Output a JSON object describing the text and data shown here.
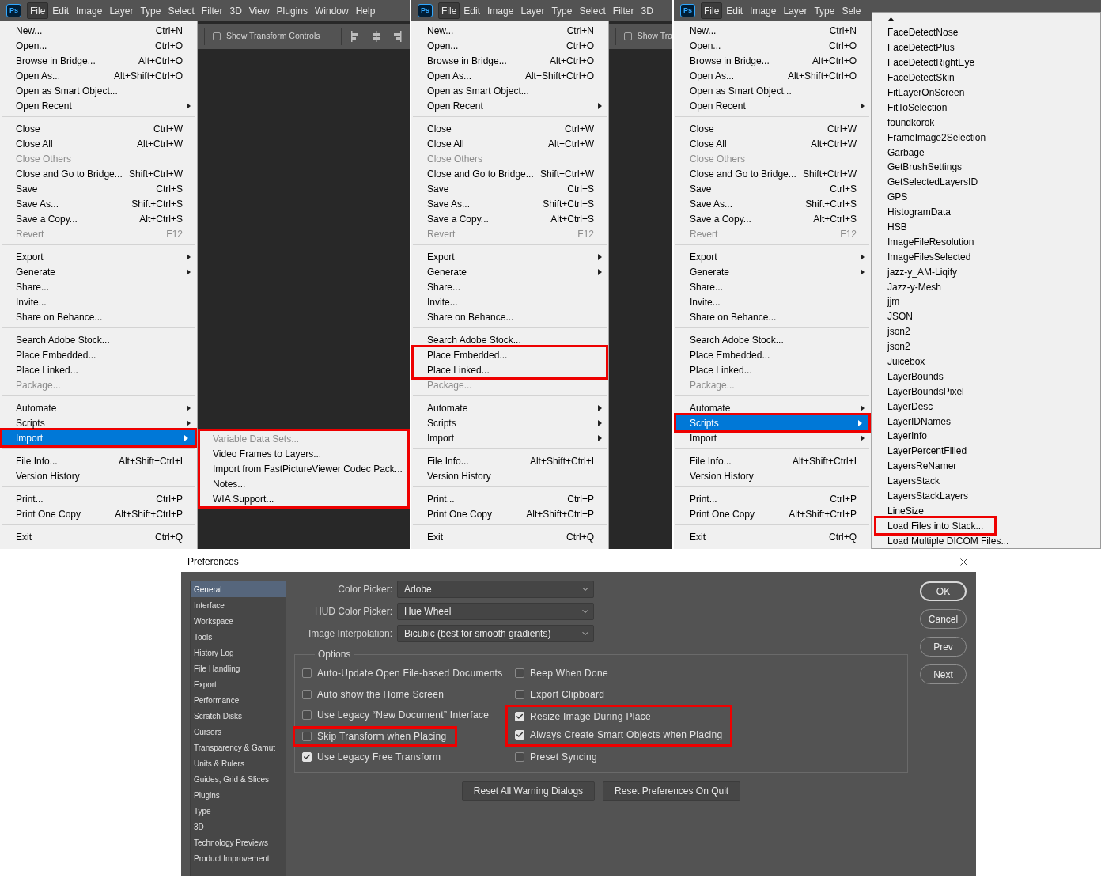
{
  "panels": [
    {
      "menubar": {
        "logo": "Ps",
        "items": [
          {
            "label": "File",
            "selected": true
          },
          {
            "label": "Edit",
            "selected": false
          },
          {
            "label": "Image",
            "selected": false
          },
          {
            "label": "Layer",
            "selected": false
          },
          {
            "label": "Type",
            "selected": false
          },
          {
            "label": "Select",
            "selected": false
          },
          {
            "label": "Filter",
            "selected": false
          },
          {
            "label": "3D",
            "selected": false
          },
          {
            "label": "View",
            "selected": false
          },
          {
            "label": "Plugins",
            "selected": false
          },
          {
            "label": "Window",
            "selected": false
          },
          {
            "label": "Help",
            "selected": false
          }
        ]
      },
      "options_bar": {
        "label": "Show Transform Controls",
        "checked": false,
        "align_icons": true
      },
      "file_menu": {
        "sections": [
          [
            {
              "label": "New...",
              "shortcut": "Ctrl+N",
              "arrow": false,
              "disabled": false,
              "selected": false,
              "annotated": false
            },
            {
              "label": "Open...",
              "shortcut": "Ctrl+O",
              "arrow": false,
              "disabled": false,
              "selected": false,
              "annotated": false
            },
            {
              "label": "Browse in Bridge...",
              "shortcut": "Alt+Ctrl+O",
              "arrow": false,
              "disabled": false,
              "selected": false,
              "annotated": false
            },
            {
              "label": "Open As...",
              "shortcut": "Alt+Shift+Ctrl+O",
              "arrow": false,
              "disabled": false,
              "selected": false,
              "annotated": false
            },
            {
              "label": "Open as Smart Object...",
              "arrow": false,
              "disabled": false,
              "selected": false,
              "annotated": false
            },
            {
              "label": "Open Recent",
              "arrow": true,
              "disabled": false,
              "selected": false,
              "annotated": false
            }
          ],
          [
            {
              "label": "Close",
              "shortcut": "Ctrl+W",
              "arrow": false,
              "disabled": false,
              "selected": false,
              "annotated": false
            },
            {
              "label": "Close All",
              "shortcut": "Alt+Ctrl+W",
              "arrow": false,
              "disabled": false,
              "selected": false,
              "annotated": false
            },
            {
              "label": "Close Others",
              "arrow": false,
              "disabled": true,
              "selected": false,
              "annotated": false
            },
            {
              "label": "Close and Go to Bridge...",
              "shortcut": "Shift+Ctrl+W",
              "arrow": false,
              "disabled": false,
              "selected": false,
              "annotated": false
            },
            {
              "label": "Save",
              "shortcut": "Ctrl+S",
              "arrow": false,
              "disabled": false,
              "selected": false,
              "annotated": false
            },
            {
              "label": "Save As...",
              "shortcut": "Shift+Ctrl+S",
              "arrow": false,
              "disabled": false,
              "selected": false,
              "annotated": false
            },
            {
              "label": "Save a Copy...",
              "shortcut": "Alt+Ctrl+S",
              "arrow": false,
              "disabled": false,
              "selected": false,
              "annotated": false
            },
            {
              "label": "Revert",
              "shortcut": "F12",
              "arrow": false,
              "disabled": true,
              "selected": false,
              "annotated": false
            }
          ],
          [
            {
              "label": "Export",
              "arrow": true,
              "disabled": false,
              "selected": false,
              "annotated": false
            },
            {
              "label": "Generate",
              "arrow": true,
              "disabled": false,
              "selected": false,
              "annotated": false
            },
            {
              "label": "Share...",
              "arrow": false,
              "disabled": false,
              "selected": false,
              "annotated": false
            },
            {
              "label": "Invite...",
              "arrow": false,
              "disabled": false,
              "selected": false,
              "annotated": false
            },
            {
              "label": "Share on Behance...",
              "arrow": false,
              "disabled": false,
              "selected": false,
              "annotated": false
            }
          ],
          [
            {
              "label": "Search Adobe Stock...",
              "arrow": false,
              "disabled": false,
              "selected": false,
              "annotated": false
            },
            {
              "label": "Place Embedded...",
              "arrow": false,
              "disabled": false,
              "selected": false,
              "annotated": false
            },
            {
              "label": "Place Linked...",
              "arrow": false,
              "disabled": false,
              "selected": false,
              "annotated": false
            },
            {
              "label": "Package...",
              "arrow": false,
              "disabled": true,
              "selected": false,
              "annotated": false
            }
          ],
          [
            {
              "label": "Automate",
              "arrow": true,
              "disabled": false,
              "selected": false,
              "annotated": false
            },
            {
              "label": "Scripts",
              "arrow": true,
              "disabled": false,
              "selected": false,
              "annotated": false
            },
            {
              "label": "Import",
              "arrow": true,
              "disabled": false,
              "selected": true,
              "annotated": true,
              "submenu": {
                "kind": "cascade",
                "annotated": true,
                "scroll_up": false,
                "items": [
                  {
                    "label": "Variable Data Sets...",
                    "disabled": true,
                    "annotated": false
                  },
                  {
                    "label": "Video Frames to Layers...",
                    "disabled": false,
                    "annotated": false
                  },
                  {
                    "label": "Import from FastPictureViewer Codec Pack...",
                    "disabled": false,
                    "annotated": false
                  },
                  {
                    "label": "Notes...",
                    "disabled": false,
                    "annotated": false
                  },
                  {
                    "label": "WIA Support...",
                    "disabled": false,
                    "annotated": false
                  }
                ]
              }
            }
          ],
          [
            {
              "label": "File Info...",
              "shortcut": "Alt+Shift+Ctrl+I",
              "arrow": false,
              "disabled": false,
              "selected": false,
              "annotated": false
            },
            {
              "label": "Version History",
              "arrow": false,
              "disabled": false,
              "selected": false,
              "annotated": false
            }
          ],
          [
            {
              "label": "Print...",
              "shortcut": "Ctrl+P",
              "arrow": false,
              "disabled": false,
              "selected": false,
              "annotated": false
            },
            {
              "label": "Print One Copy",
              "shortcut": "Alt+Shift+Ctrl+P",
              "arrow": false,
              "disabled": false,
              "selected": false,
              "annotated": false
            }
          ],
          [
            {
              "label": "Exit",
              "shortcut": "Ctrl+Q",
              "arrow": false,
              "disabled": false,
              "selected": false,
              "annotated": false
            }
          ]
        ]
      }
    },
    {
      "menubar": {
        "logo": "Ps",
        "items": [
          {
            "label": "File",
            "selected": true
          },
          {
            "label": "Edit",
            "selected": false
          },
          {
            "label": "Image",
            "selected": false
          },
          {
            "label": "Layer",
            "selected": false
          },
          {
            "label": "Type",
            "selected": false
          },
          {
            "label": "Select",
            "selected": false
          },
          {
            "label": "Filter",
            "selected": false
          },
          {
            "label": "3D",
            "selected": false
          }
        ]
      },
      "options_bar": {
        "label": "Show Tra",
        "checked": false,
        "align_icons": false
      },
      "file_menu": {
        "sections": [
          [
            {
              "label": "New...",
              "shortcut": "Ctrl+N",
              "arrow": false,
              "disabled": false,
              "selected": false,
              "annotated": false
            },
            {
              "label": "Open...",
              "shortcut": "Ctrl+O",
              "arrow": false,
              "disabled": false,
              "selected": false,
              "annotated": false
            },
            {
              "label": "Browse in Bridge...",
              "shortcut": "Alt+Ctrl+O",
              "arrow": false,
              "disabled": false,
              "selected": false,
              "annotated": false
            },
            {
              "label": "Open As...",
              "shortcut": "Alt+Shift+Ctrl+O",
              "arrow": false,
              "disabled": false,
              "selected": false,
              "annotated": false
            },
            {
              "label": "Open as Smart Object...",
              "arrow": false,
              "disabled": false,
              "selected": false,
              "annotated": false
            },
            {
              "label": "Open Recent",
              "arrow": true,
              "disabled": false,
              "selected": false,
              "annotated": false
            }
          ],
          [
            {
              "label": "Close",
              "shortcut": "Ctrl+W",
              "arrow": false,
              "disabled": false,
              "selected": false,
              "annotated": false
            },
            {
              "label": "Close All",
              "shortcut": "Alt+Ctrl+W",
              "arrow": false,
              "disabled": false,
              "selected": false,
              "annotated": false
            },
            {
              "label": "Close Others",
              "arrow": false,
              "disabled": true,
              "selected": false,
              "annotated": false
            },
            {
              "label": "Close and Go to Bridge...",
              "shortcut": "Shift+Ctrl+W",
              "arrow": false,
              "disabled": false,
              "selected": false,
              "annotated": false
            },
            {
              "label": "Save",
              "shortcut": "Ctrl+S",
              "arrow": false,
              "disabled": false,
              "selected": false,
              "annotated": false
            },
            {
              "label": "Save As...",
              "shortcut": "Shift+Ctrl+S",
              "arrow": false,
              "disabled": false,
              "selected": false,
              "annotated": false
            },
            {
              "label": "Save a Copy...",
              "shortcut": "Alt+Ctrl+S",
              "arrow": false,
              "disabled": false,
              "selected": false,
              "annotated": false
            },
            {
              "label": "Revert",
              "shortcut": "F12",
              "arrow": false,
              "disabled": true,
              "selected": false,
              "annotated": false
            }
          ],
          [
            {
              "label": "Export",
              "arrow": true,
              "disabled": false,
              "selected": false,
              "annotated": false
            },
            {
              "label": "Generate",
              "arrow": true,
              "disabled": false,
              "selected": false,
              "annotated": false
            },
            {
              "label": "Share...",
              "arrow": false,
              "disabled": false,
              "selected": false,
              "annotated": false
            },
            {
              "label": "Invite...",
              "arrow": false,
              "disabled": false,
              "selected": false,
              "annotated": false
            },
            {
              "label": "Share on Behance...",
              "arrow": false,
              "disabled": false,
              "selected": false,
              "annotated": false
            }
          ],
          [
            {
              "label": "Search Adobe Stock...",
              "arrow": false,
              "disabled": false,
              "selected": false,
              "annotated": false
            },
            {
              "label": "Place Embedded...",
              "arrow": false,
              "disabled": false,
              "selected": false,
              "annotated": true
            },
            {
              "label": "Place Linked...",
              "arrow": false,
              "disabled": false,
              "selected": false,
              "annotated": true
            },
            {
              "label": "Package...",
              "arrow": false,
              "disabled": true,
              "selected": false,
              "annotated": false
            }
          ],
          [
            {
              "label": "Automate",
              "arrow": true,
              "disabled": false,
              "selected": false,
              "annotated": false
            },
            {
              "label": "Scripts",
              "arrow": true,
              "disabled": false,
              "selected": false,
              "annotated": false
            },
            {
              "label": "Import",
              "arrow": true,
              "disabled": false,
              "selected": false,
              "annotated": false
            }
          ],
          [
            {
              "label": "File Info...",
              "shortcut": "Alt+Shift+Ctrl+I",
              "arrow": false,
              "disabled": false,
              "selected": false,
              "annotated": false
            },
            {
              "label": "Version History",
              "arrow": false,
              "disabled": false,
              "selected": false,
              "annotated": false
            }
          ],
          [
            {
              "label": "Print...",
              "shortcut": "Ctrl+P",
              "arrow": false,
              "disabled": false,
              "selected": false,
              "annotated": false
            },
            {
              "label": "Print One Copy",
              "shortcut": "Alt+Shift+Ctrl+P",
              "arrow": false,
              "disabled": false,
              "selected": false,
              "annotated": false
            }
          ],
          [
            {
              "label": "Exit",
              "shortcut": "Ctrl+Q",
              "arrow": false,
              "disabled": false,
              "selected": false,
              "annotated": false
            }
          ]
        ]
      }
    },
    {
      "menubar": {
        "logo": "Ps",
        "items": [
          {
            "label": "File",
            "selected": true
          },
          {
            "label": "Edit",
            "selected": false
          },
          {
            "label": "Image",
            "selected": false
          },
          {
            "label": "Layer",
            "selected": false
          },
          {
            "label": "Type",
            "selected": false
          },
          {
            "label": "Sele",
            "selected": false
          }
        ]
      },
      "file_menu": {
        "sections": [
          [
            {
              "label": "New...",
              "shortcut": "Ctrl+N",
              "arrow": false,
              "disabled": false,
              "selected": false,
              "annotated": false
            },
            {
              "label": "Open...",
              "shortcut": "Ctrl+O",
              "arrow": false,
              "disabled": false,
              "selected": false,
              "annotated": false
            },
            {
              "label": "Browse in Bridge...",
              "shortcut": "Alt+Ctrl+O",
              "arrow": false,
              "disabled": false,
              "selected": false,
              "annotated": false
            },
            {
              "label": "Open As...",
              "shortcut": "Alt+Shift+Ctrl+O",
              "arrow": false,
              "disabled": false,
              "selected": false,
              "annotated": false
            },
            {
              "label": "Open as Smart Object...",
              "arrow": false,
              "disabled": false,
              "selected": false,
              "annotated": false
            },
            {
              "label": "Open Recent",
              "arrow": true,
              "disabled": false,
              "selected": false,
              "annotated": false
            }
          ],
          [
            {
              "label": "Close",
              "shortcut": "Ctrl+W",
              "arrow": false,
              "disabled": false,
              "selected": false,
              "annotated": false
            },
            {
              "label": "Close All",
              "shortcut": "Alt+Ctrl+W",
              "arrow": false,
              "disabled": false,
              "selected": false,
              "annotated": false
            },
            {
              "label": "Close Others",
              "arrow": false,
              "disabled": true,
              "selected": false,
              "annotated": false
            },
            {
              "label": "Close and Go to Bridge...",
              "shortcut": "Shift+Ctrl+W",
              "arrow": false,
              "disabled": false,
              "selected": false,
              "annotated": false
            },
            {
              "label": "Save",
              "shortcut": "Ctrl+S",
              "arrow": false,
              "disabled": false,
              "selected": false,
              "annotated": false
            },
            {
              "label": "Save As...",
              "shortcut": "Shift+Ctrl+S",
              "arrow": false,
              "disabled": false,
              "selected": false,
              "annotated": false
            },
            {
              "label": "Save a Copy...",
              "shortcut": "Alt+Ctrl+S",
              "arrow": false,
              "disabled": false,
              "selected": false,
              "annotated": false
            },
            {
              "label": "Revert",
              "shortcut": "F12",
              "arrow": false,
              "disabled": true,
              "selected": false,
              "annotated": false
            }
          ],
          [
            {
              "label": "Export",
              "arrow": true,
              "disabled": false,
              "selected": false,
              "annotated": false
            },
            {
              "label": "Generate",
              "arrow": true,
              "disabled": false,
              "selected": false,
              "annotated": false
            },
            {
              "label": "Share...",
              "arrow": false,
              "disabled": false,
              "selected": false,
              "annotated": false
            },
            {
              "label": "Invite...",
              "arrow": false,
              "disabled": false,
              "selected": false,
              "annotated": false
            },
            {
              "label": "Share on Behance...",
              "arrow": false,
              "disabled": false,
              "selected": false,
              "annotated": false
            }
          ],
          [
            {
              "label": "Search Adobe Stock...",
              "arrow": false,
              "disabled": false,
              "selected": false,
              "annotated": false
            },
            {
              "label": "Place Embedded...",
              "arrow": false,
              "disabled": false,
              "selected": false,
              "annotated": false
            },
            {
              "label": "Place Linked...",
              "arrow": false,
              "disabled": false,
              "selected": false,
              "annotated": false
            },
            {
              "label": "Package...",
              "arrow": false,
              "disabled": true,
              "selected": false,
              "annotated": false
            }
          ],
          [
            {
              "label": "Automate",
              "arrow": true,
              "disabled": false,
              "selected": false,
              "annotated": false
            },
            {
              "label": "Scripts",
              "arrow": true,
              "disabled": false,
              "selected": true,
              "annotated": true,
              "submenu": {
                "kind": "scrolling",
                "annotated": false,
                "scroll_up": true,
                "items": [
                  {
                    "label": "FaceDetectNose",
                    "disabled": false,
                    "annotated": false
                  },
                  {
                    "label": "FaceDetectPlus",
                    "disabled": false,
                    "annotated": false
                  },
                  {
                    "label": "FaceDetectRightEye",
                    "disabled": false,
                    "annotated": false
                  },
                  {
                    "label": "FaceDetectSkin",
                    "disabled": false,
                    "annotated": false
                  },
                  {
                    "label": "FitLayerOnScreen",
                    "disabled": false,
                    "annotated": false
                  },
                  {
                    "label": "FitToSelection",
                    "disabled": false,
                    "annotated": false
                  },
                  {
                    "label": "foundkorok",
                    "disabled": false,
                    "annotated": false
                  },
                  {
                    "label": "FrameImage2Selection",
                    "disabled": false,
                    "annotated": false
                  },
                  {
                    "label": "Garbage",
                    "disabled": false,
                    "annotated": false
                  },
                  {
                    "label": "GetBrushSettings",
                    "disabled": false,
                    "annotated": false
                  },
                  {
                    "label": "GetSelectedLayersID",
                    "disabled": false,
                    "annotated": false
                  },
                  {
                    "label": "GPS",
                    "disabled": false,
                    "annotated": false
                  },
                  {
                    "label": "HistogramData",
                    "disabled": false,
                    "annotated": false
                  },
                  {
                    "label": "HSB",
                    "disabled": false,
                    "annotated": false
                  },
                  {
                    "label": "ImageFileResolution",
                    "disabled": false,
                    "annotated": false
                  },
                  {
                    "label": "ImageFilesSelected",
                    "disabled": false,
                    "annotated": false
                  },
                  {
                    "label": "jazz-y_AM-Liqify",
                    "disabled": false,
                    "annotated": false
                  },
                  {
                    "label": "Jazz-y-Mesh",
                    "disabled": false,
                    "annotated": false
                  },
                  {
                    "label": "jjm",
                    "disabled": false,
                    "annotated": false
                  },
                  {
                    "label": "JSON",
                    "disabled": false,
                    "annotated": false
                  },
                  {
                    "label": "json2",
                    "disabled": false,
                    "annotated": false
                  },
                  {
                    "label": "json2",
                    "disabled": false,
                    "annotated": false
                  },
                  {
                    "label": "Juicebox",
                    "disabled": false,
                    "annotated": false
                  },
                  {
                    "label": "LayerBounds",
                    "disabled": false,
                    "annotated": false
                  },
                  {
                    "label": "LayerBoundsPixel",
                    "disabled": false,
                    "annotated": false
                  },
                  {
                    "label": "LayerDesc",
                    "disabled": false,
                    "annotated": false
                  },
                  {
                    "label": "LayerIDNames",
                    "disabled": false,
                    "annotated": false
                  },
                  {
                    "label": "LayerInfo",
                    "disabled": false,
                    "annotated": false
                  },
                  {
                    "label": "LayerPercentFilled",
                    "disabled": false,
                    "annotated": false
                  },
                  {
                    "label": "LayersReNamer",
                    "disabled": false,
                    "annotated": false
                  },
                  {
                    "label": "LayersStack",
                    "disabled": false,
                    "annotated": false
                  },
                  {
                    "label": "LayersStackLayers",
                    "disabled": false,
                    "annotated": false
                  },
                  {
                    "label": "LineSize",
                    "disabled": false,
                    "annotated": false
                  },
                  {
                    "label": "Load Files into Stack...",
                    "disabled": false,
                    "annotated": true
                  },
                  {
                    "label": "Load Multiple DICOM Files...",
                    "disabled": false,
                    "annotated": false
                  }
                ]
              }
            },
            {
              "label": "Import",
              "arrow": true,
              "disabled": false,
              "selected": false,
              "annotated": false
            }
          ],
          [
            {
              "label": "File Info...",
              "shortcut": "Alt+Shift+Ctrl+I",
              "arrow": false,
              "disabled": false,
              "selected": false,
              "annotated": false
            },
            {
              "label": "Version History",
              "arrow": false,
              "disabled": false,
              "selected": false,
              "annotated": false
            }
          ],
          [
            {
              "label": "Print...",
              "shortcut": "Ctrl+P",
              "arrow": false,
              "disabled": false,
              "selected": false,
              "annotated": false
            },
            {
              "label": "Print One Copy",
              "shortcut": "Alt+Shift+Ctrl+P",
              "arrow": false,
              "disabled": false,
              "selected": false,
              "annotated": false
            }
          ],
          [
            {
              "label": "Exit",
              "shortcut": "Ctrl+Q",
              "arrow": false,
              "disabled": false,
              "selected": false,
              "annotated": false
            }
          ]
        ]
      }
    }
  ],
  "preferences": {
    "title": "Preferences",
    "sidebar": [
      {
        "label": "General",
        "selected": true
      },
      {
        "label": "Interface",
        "selected": false
      },
      {
        "label": "Workspace",
        "selected": false
      },
      {
        "label": "Tools",
        "selected": false
      },
      {
        "label": "History Log",
        "selected": false
      },
      {
        "label": "File Handling",
        "selected": false
      },
      {
        "label": "Export",
        "selected": false
      },
      {
        "label": "Performance",
        "selected": false
      },
      {
        "label": "Scratch Disks",
        "selected": false
      },
      {
        "label": "Cursors",
        "selected": false
      },
      {
        "label": "Transparency & Gamut",
        "selected": false
      },
      {
        "label": "Units & Rulers",
        "selected": false
      },
      {
        "label": "Guides, Grid & Slices",
        "selected": false
      },
      {
        "label": "Plugins",
        "selected": false
      },
      {
        "label": "Type",
        "selected": false
      },
      {
        "label": "3D",
        "selected": false
      },
      {
        "label": "Technology Previews",
        "selected": false
      },
      {
        "label": "Product Improvement",
        "selected": false
      }
    ],
    "fields": [
      {
        "label": "Color Picker:",
        "value": "Adobe"
      },
      {
        "label": "HUD Color Picker:",
        "value": "Hue Wheel"
      },
      {
        "label": "Image Interpolation:",
        "value": "Bicubic (best for smooth gradients)"
      }
    ],
    "options": {
      "title": "Options",
      "columns": [
        [
          {
            "label": "Auto-Update Open File-based Documents",
            "checked": false,
            "annotated": false
          },
          {
            "label": "Auto show the Home Screen",
            "checked": false,
            "annotated": false
          },
          {
            "label": "Use Legacy “New Document” Interface",
            "checked": false,
            "annotated": false
          },
          {
            "label": "Skip Transform when Placing",
            "checked": false,
            "annotated": true
          },
          {
            "label": "Use Legacy Free Transform",
            "checked": true,
            "annotated": false
          }
        ],
        [
          {
            "label": "Beep When Done",
            "checked": false,
            "annotated": false
          },
          {
            "label": "Export Clipboard",
            "checked": false,
            "annotated": false
          },
          {
            "label": "Resize Image During Place",
            "checked": true,
            "annotated": true
          },
          {
            "label": "Always Create Smart Objects when Placing",
            "checked": true,
            "annotated": true
          },
          {
            "label": "Preset Syncing",
            "checked": false,
            "annotated": false
          }
        ]
      ]
    },
    "buttons": [
      "Reset All Warning Dialogs",
      "Reset Preferences On Quit"
    ],
    "side_buttons": [
      {
        "label": "OK",
        "default": true
      },
      {
        "label": "Cancel",
        "default": false
      },
      {
        "label": "Prev",
        "default": false
      },
      {
        "label": "Next",
        "default": false
      }
    ]
  }
}
